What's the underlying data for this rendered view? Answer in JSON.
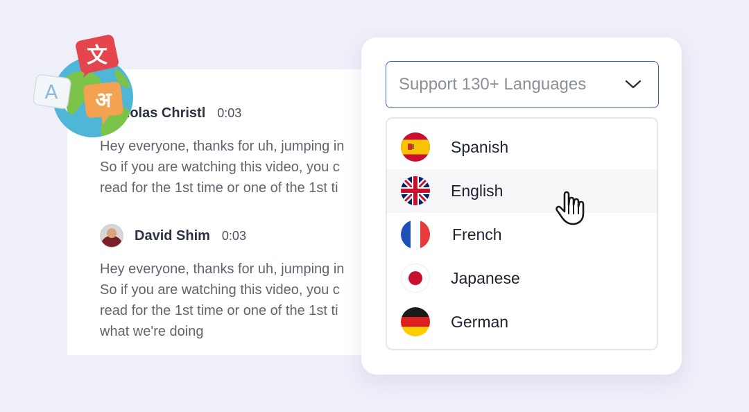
{
  "transcript": {
    "entries": [
      {
        "speaker": "Nicholas Christl",
        "time": "0:03",
        "lines": [
          "Hey everyone, thanks for uh, jumping in",
          "So if you are watching this video, you c",
          "read for the 1st time or one of the 1st ti"
        ]
      },
      {
        "speaker": "David Shim",
        "time": "0:03",
        "lines": [
          "Hey everyone, thanks for uh, jumping in",
          "So if you are watching this video, you c",
          "read for the 1st time or one of the 1st ti",
          "what we're doing"
        ]
      }
    ]
  },
  "globe": {
    "badge_chinese": "文",
    "badge_latin": "A",
    "badge_hindi": "अ"
  },
  "language_select": {
    "placeholder": "Support 130+ Languages",
    "options": [
      {
        "label": "Spanish",
        "flag": "spain-flag-icon"
      },
      {
        "label": "English",
        "flag": "uk-flag-icon"
      },
      {
        "label": "French",
        "flag": "france-flag-icon"
      },
      {
        "label": "Japanese",
        "flag": "japan-flag-icon"
      },
      {
        "label": "German",
        "flag": "germany-flag-icon"
      }
    ],
    "hovered": "English"
  },
  "colors": {
    "background": "#efeffa",
    "select_border": "#3d5cb8",
    "text_dark": "#1e2230",
    "globe_ocean": "#4fb6d8",
    "globe_land": "#7cc34a"
  }
}
